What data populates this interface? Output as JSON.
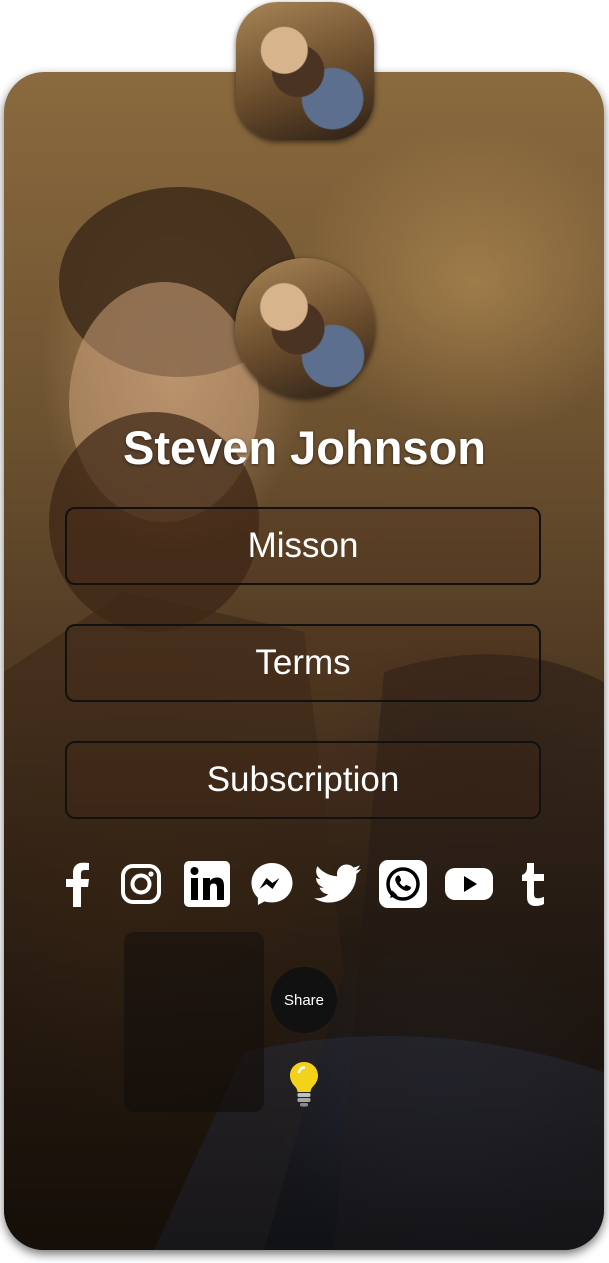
{
  "profile": {
    "name": "Steven Johnson"
  },
  "links": [
    {
      "label": "Misson"
    },
    {
      "label": "Terms"
    },
    {
      "label": "Subscription"
    }
  ],
  "socials": [
    {
      "icon": "facebook-icon"
    },
    {
      "icon": "instagram-icon"
    },
    {
      "icon": "linkedin-icon"
    },
    {
      "icon": "messenger-icon"
    },
    {
      "icon": "twitter-icon"
    },
    {
      "icon": "whatsapp-icon"
    },
    {
      "icon": "youtube-icon"
    },
    {
      "icon": "tumblr-icon"
    }
  ],
  "share": {
    "label": "Share"
  },
  "colors": {
    "text": "#ffffff",
    "button_border": "#111111",
    "share_bg": "#111111",
    "bulb": "#f5d21a"
  }
}
